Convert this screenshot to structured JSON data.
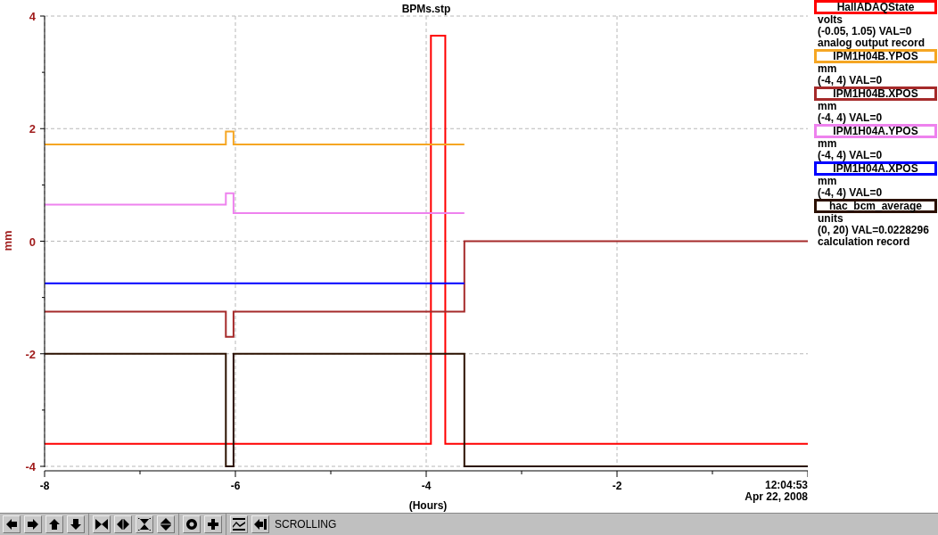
{
  "chart": {
    "chart_data": {
      "type": "line",
      "title": "BPMs.stp",
      "xlabel": "(Hours)",
      "ylabel": "mm",
      "x": [
        -8,
        -6.1,
        -6.1,
        -6.02,
        -6.02,
        -3.95,
        -3.95,
        -3.8,
        -3.8,
        -3.6,
        -3.6,
        0
      ],
      "series": [
        {
          "name": "HallADAQState",
          "color": "#ff0000",
          "values": [
            -3.6,
            -3.6,
            -3.6,
            -3.6,
            -3.6,
            -3.6,
            3.65,
            3.65,
            -3.6,
            -3.6,
            -3.6,
            -3.6
          ]
        },
        {
          "name": "IPM1H04B.YPOS",
          "color": "#f5a623",
          "values": [
            1.72,
            1.72,
            1.95,
            1.95,
            1.72,
            1.72,
            1.72,
            1.72,
            1.72,
            1.72,
            null,
            null
          ]
        },
        {
          "name": "IPM1H04B.XPOS",
          "color": "#a52a2a",
          "values": [
            -1.25,
            -1.25,
            -1.7,
            -1.7,
            -1.25,
            -1.25,
            -1.25,
            -1.25,
            -1.25,
            -1.25,
            0,
            0
          ]
        },
        {
          "name": "IPM1H04A.YPOS",
          "color": "#ee82ee",
          "values": [
            0.65,
            0.65,
            0.85,
            0.85,
            0.5,
            0.5,
            0.5,
            0.5,
            0.5,
            0.5,
            null,
            null
          ]
        },
        {
          "name": "IPM1H04A.XPOS",
          "color": "#0000ff",
          "values": [
            -0.75,
            -0.75,
            -0.75,
            -0.75,
            -0.75,
            -0.75,
            -0.75,
            -0.75,
            -0.75,
            -0.75,
            null,
            null
          ]
        },
        {
          "name": "hac_bcm_average",
          "color": "#2b1100",
          "values": [
            -2,
            -2,
            -4,
            -4,
            -2,
            -2,
            -2,
            -2,
            -2,
            -2,
            -4,
            -4
          ]
        }
      ],
      "grid": true,
      "xlim": [
        -8,
        0
      ],
      "ylim": [
        -4,
        4
      ],
      "xticks": [
        -8,
        -6,
        -4,
        -2
      ],
      "yticks": [
        -4,
        -2,
        0,
        2,
        4
      ]
    },
    "time": "12:04:53",
    "date": "Apr 22, 2008"
  },
  "legend": [
    {
      "units": "volts",
      "range": "(-0.05, 1.05) VAL=0",
      "record": "analog output record"
    },
    {
      "units": "mm",
      "range": "(-4, 4) VAL=0"
    },
    {
      "units": "mm",
      "range": "(-4, 4) VAL=0"
    },
    {
      "units": "mm",
      "range": "(-4, 4) VAL=0"
    },
    {
      "units": "mm",
      "range": "(-4, 4) VAL=0"
    },
    {
      "units": "units",
      "range": "(0, 20) VAL=0.0228296",
      "record": "calculation record"
    }
  ],
  "status": "SCROLLING"
}
